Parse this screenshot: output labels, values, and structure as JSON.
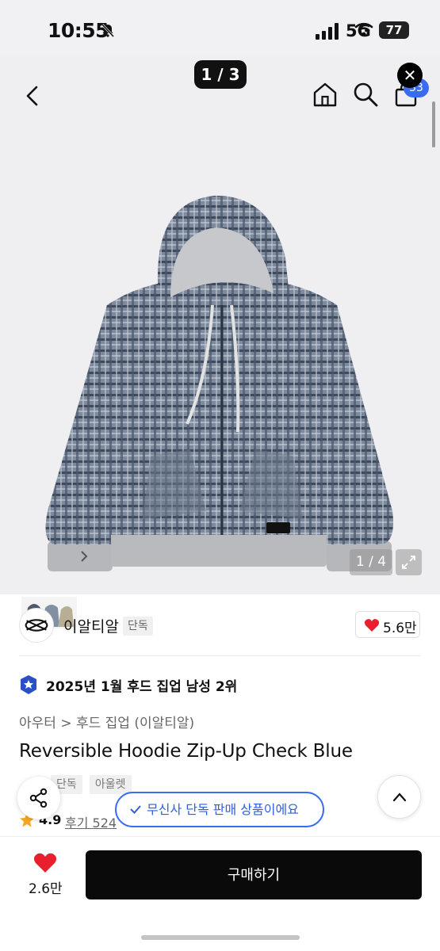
{
  "status_bar": {
    "time": "10:55",
    "network": "5G",
    "battery": "77"
  },
  "nav": {
    "page_indicator": "1 / 3",
    "cart_count": "33",
    "close_icon": "close-icon"
  },
  "gallery": {
    "image_counter": "1 / 4"
  },
  "brand": {
    "name": "이알티알",
    "exclusive_tag": "단독",
    "likes": "5.6만"
  },
  "ranking": {
    "text": "2025년 1월 후드 집업 남성 2위",
    "chevron": "›"
  },
  "breadcrumb": "아우터 > 후드 집업 (이알티알)",
  "product": {
    "title": "Reversible Hoodie Zip-Up Check Blue",
    "tags": [
      "단독",
      "아울렛"
    ],
    "rating": "4.9",
    "reviews": "후기 524"
  },
  "toast": "무신사 단독 판매 상품이에요",
  "bottom_bar": {
    "likes": "2.6만",
    "buy_label": "구매하기"
  },
  "colors": {
    "accent_blue": "#3a6cf3",
    "heart_red": "#e8202d",
    "buy_button": "#0a0a0a"
  }
}
